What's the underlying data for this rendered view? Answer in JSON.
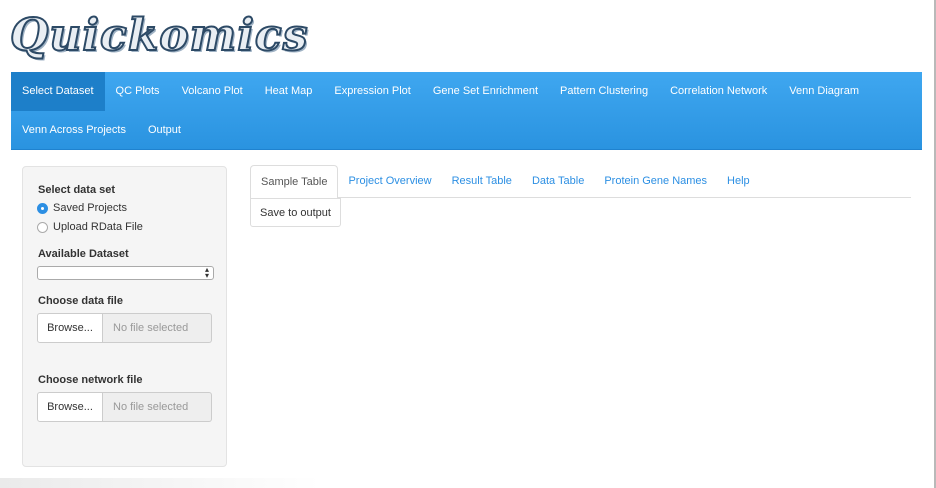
{
  "app": {
    "logo_text": "Quickomics"
  },
  "navbar": {
    "row1": [
      "Select Dataset",
      "QC Plots",
      "Volcano Plot",
      "Heat Map",
      "Expression Plot",
      "Gene Set Enrichment",
      "Pattern Clustering",
      "Correlation Network",
      "Venn Diagram"
    ],
    "row2": [
      "Venn Across Projects",
      "Output"
    ],
    "active": "Select Dataset"
  },
  "sidebar": {
    "select_data_set_label": "Select data set",
    "radio_saved": "Saved Projects",
    "radio_upload": "Upload RData File",
    "available_dataset_label": "Available Dataset",
    "available_dataset_value": "",
    "choose_data_file_label": "Choose data file",
    "choose_network_file_label": "Choose network file",
    "browse_label": "Browse...",
    "no_file_text": "No file selected"
  },
  "tabs": {
    "items": [
      "Sample Table",
      "Project Overview",
      "Result Table",
      "Data Table",
      "Protein Gene Names",
      "Help"
    ],
    "active": "Sample Table"
  },
  "main": {
    "save_button": "Save to output"
  },
  "colors": {
    "navbar": "#2a93e0",
    "navbar_active": "#1d7fc9",
    "link": "#2c8fe3"
  }
}
